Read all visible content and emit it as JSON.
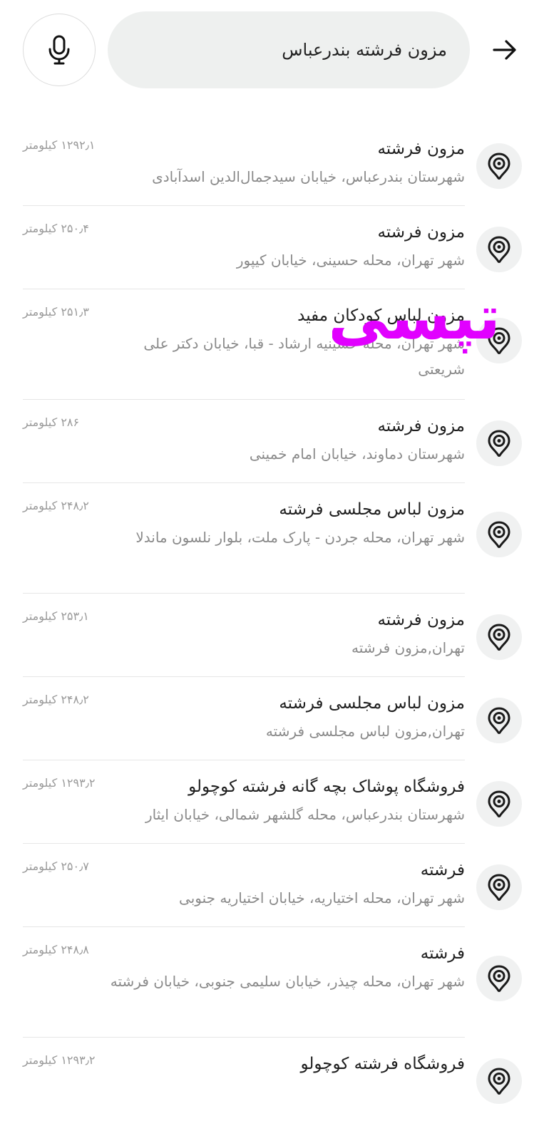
{
  "search": {
    "value": "مزون فرشته بندرعباس"
  },
  "icons": {
    "back": "arrow-right-icon",
    "mic": "microphone-icon",
    "pin": "location-pin-icon"
  },
  "colors": {
    "pill_bg": "#eef0ef",
    "pin_bg": "#f0f1f1",
    "watermark": "#e100ff"
  },
  "watermark_text": "تپسی",
  "results": [
    {
      "title": "مزون فرشته",
      "address": "شهرستان بندرعباس، خیابان سیدجمال‌الدین اسدآبادی",
      "distance": "۱۲۹۲٫۱ کیلومتر"
    },
    {
      "title": "مزون فرشته",
      "address": "شهر تهران، محله حسینی، خیابان کیپور",
      "distance": "۲۵۰٫۴ کیلومتر"
    },
    {
      "title": "مزون لباس کودکان مفید",
      "address": "شهر تهران، محله حسینیه ارشاد - قبا، خیابان دکتر علی شریعتی",
      "distance": "۲۵۱٫۳ کیلومتر"
    },
    {
      "title": "مزون فرشته",
      "address": "شهرستان دماوند، خیابان امام خمینی",
      "distance": "۲۸۶ کیلومتر"
    },
    {
      "title": "مزون لباس مجلسی فرشته",
      "address": "شهر تهران، محله جردن - پارک ملت، بلوار نلسون ماندلا",
      "distance": "۲۴۸٫۲ کیلومتر"
    },
    {
      "title": "مزون فرشته",
      "address": "تهران,مزون فرشته",
      "distance": "۲۵۳٫۱ کیلومتر"
    },
    {
      "title": "مزون لباس مجلسی فرشته",
      "address": "تهران,مزون لباس مجلسی فرشته",
      "distance": "۲۴۸٫۲ کیلومتر"
    },
    {
      "title": "فروشگاه پوشاک بچه گانه فرشته کوچولو",
      "address": "شهرستان بندرعباس، محله گلشهر شمالی، خیابان ایثار",
      "distance": "۱۲۹۳٫۲ کیلومتر"
    },
    {
      "title": "فرشته",
      "address": "شهر تهران، محله اختیاریه، خیابان اختیاریه جنوبی",
      "distance": "۲۵۰٫۷ کیلومتر"
    },
    {
      "title": "فرشته",
      "address": "شهر تهران، محله چیذر، خیابان سلیمی جنوبی، خیابان فرشته",
      "distance": "۲۴۸٫۸ کیلومتر"
    },
    {
      "title": "فروشگاه فرشته کوچولو",
      "address": "",
      "distance": "۱۲۹۳٫۲ کیلومتر"
    }
  ]
}
